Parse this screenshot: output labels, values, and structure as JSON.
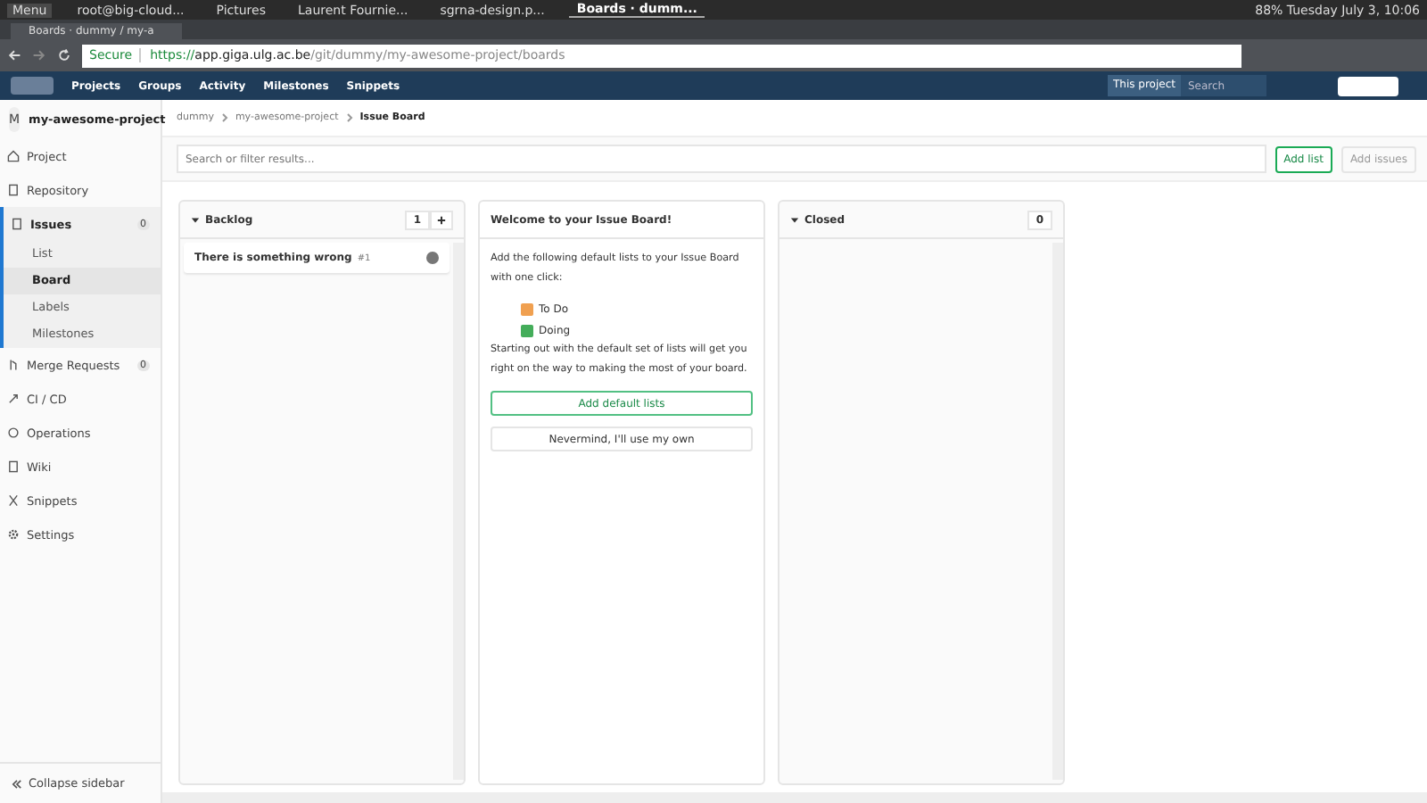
{
  "taskbar": {
    "menu_label": "Menu",
    "windows": [
      {
        "title": "root@big-cloud...",
        "selected": false
      },
      {
        "title": "Pictures",
        "selected": false
      },
      {
        "title": "Laurent Fournie...",
        "selected": false
      },
      {
        "title": "sgrna-design.p...",
        "selected": false
      },
      {
        "title": "Boards · dumm...",
        "selected": true
      }
    ],
    "status": "88% Tuesday July 3, 10:06"
  },
  "browser": {
    "tab_title": "Boards · dummy / my-a",
    "secure_label": "Secure",
    "url_scheme": "https://",
    "url_host": "app.giga.ulg.ac.be",
    "url_path": "/git/dummy/my-awesome-project/boards"
  },
  "nav": {
    "items": [
      "Projects",
      "Groups",
      "Activity",
      "Milestones",
      "Snippets"
    ],
    "search_scope": "This project",
    "search_placeholder": "Search"
  },
  "sidebar": {
    "avatar_letter": "M",
    "project_name": "my-awesome-project",
    "items": [
      {
        "label": "Project",
        "selected": false
      },
      {
        "label": "Repository",
        "selected": false
      },
      {
        "label": "Issues",
        "count": "0",
        "selected": true,
        "children": [
          {
            "label": "List",
            "selected": false
          },
          {
            "label": "Board",
            "selected": true
          },
          {
            "label": "Labels",
            "selected": false
          },
          {
            "label": "Milestones",
            "selected": false
          }
        ]
      },
      {
        "label": "Merge Requests",
        "count": "0",
        "selected": false
      },
      {
        "label": "CI / CD",
        "selected": false
      },
      {
        "label": "Operations",
        "selected": false
      },
      {
        "label": "Wiki",
        "selected": false
      },
      {
        "label": "Snippets",
        "selected": false
      },
      {
        "label": "Settings",
        "selected": false
      }
    ],
    "collapse_label": "Collapse sidebar"
  },
  "breadcrumbs": [
    "dummy",
    "my-awesome-project",
    "Issue Board"
  ],
  "filter": {
    "placeholder": "Search or filter results...",
    "add_list": "Add list",
    "add_issues": "Add issues"
  },
  "lists": [
    {
      "kind": "list",
      "title": "Backlog",
      "count": "1",
      "issues": [
        {
          "title": "There is something wrong",
          "number": "#1"
        }
      ]
    },
    {
      "kind": "welcome",
      "title": "Welcome to your Issue Board!",
      "intro": "Add the following default lists to your Issue Board with one click:",
      "labels": [
        {
          "name": "To Do",
          "color": "#f0a050"
        },
        {
          "name": "Doing",
          "color": "#44ad5a"
        }
      ],
      "outro": "Starting out with the default set of lists will get you right on the way to making the most of your board.",
      "primary_button": "Add default lists",
      "secondary_button": "Nevermind, I'll use my own"
    },
    {
      "kind": "list",
      "title": "Closed",
      "count": "0"
    }
  ]
}
